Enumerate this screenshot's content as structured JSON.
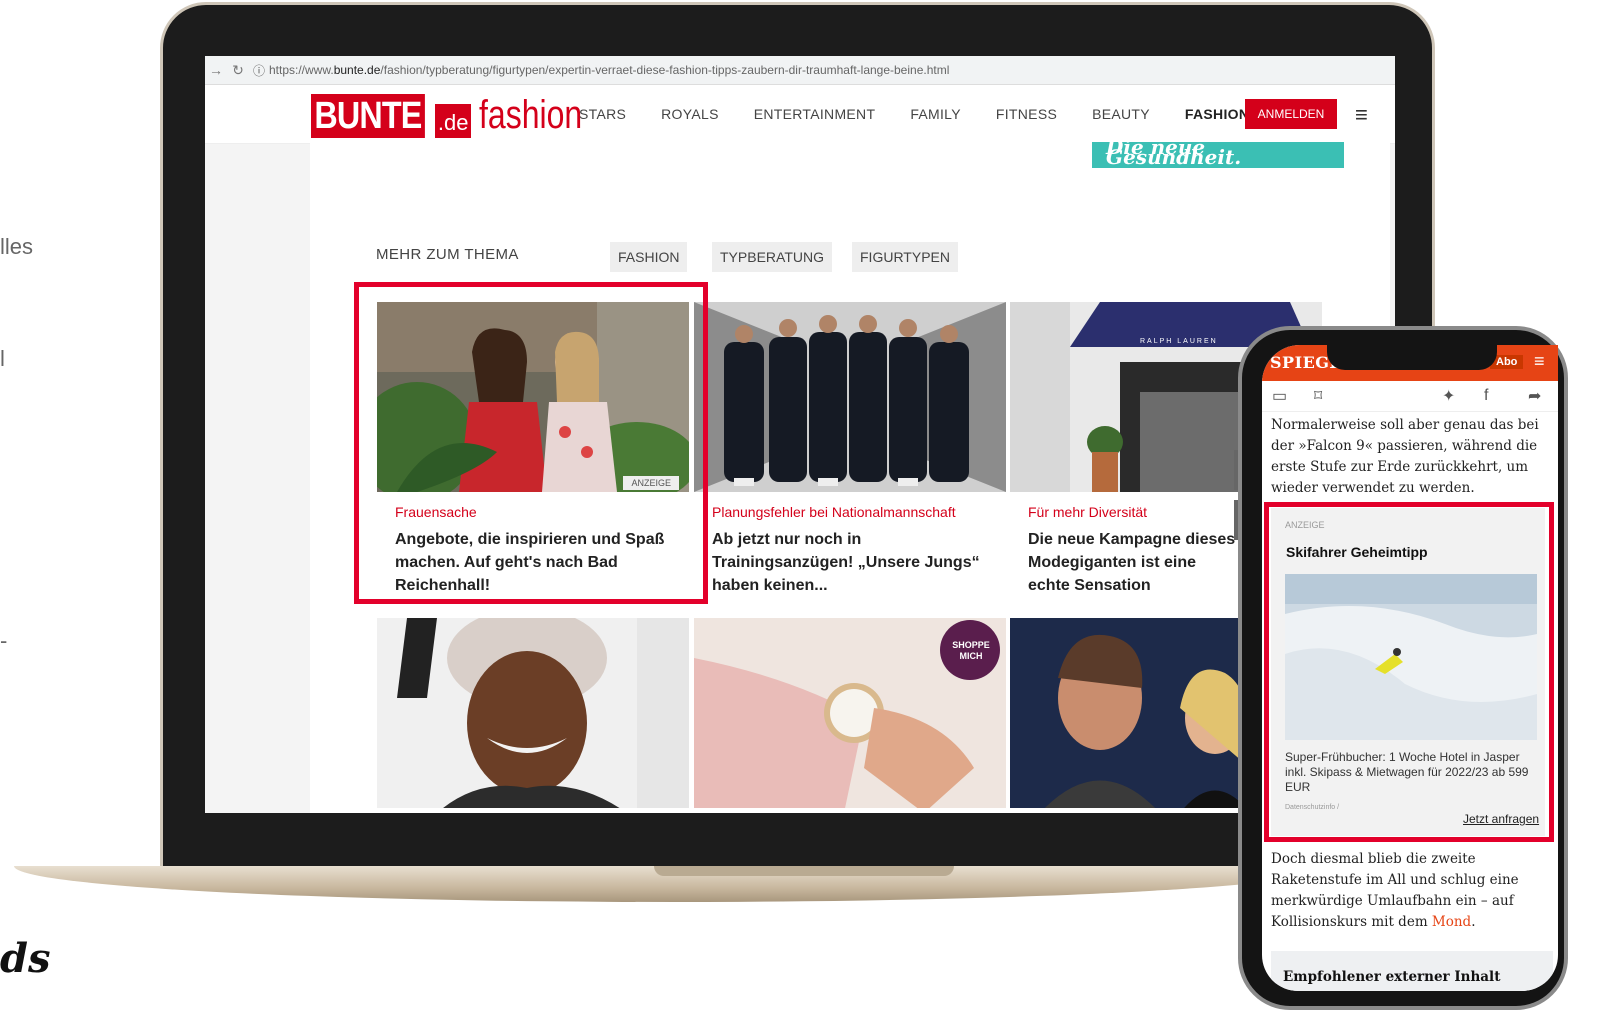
{
  "slide": {
    "frag1": "lles",
    "frag2": "l",
    "frag3": "-",
    "script_frag": "ds"
  },
  "browser": {
    "url_prefix": "https://www.",
    "url_domain": "bunte.de",
    "url_path": "/fashion/typberatung/figurtypen/expertin-verraet-diese-fashion-tipps-zaubern-dir-traumhaft-lange-beine.html"
  },
  "bunte": {
    "logo_main": "BUNTE",
    "logo_de": ".de",
    "logo_section": "fashion",
    "nav": [
      "STARS",
      "ROYALS",
      "ENTERTAINMENT",
      "FAMILY",
      "FITNESS",
      "BEAUTY",
      "FASHION"
    ],
    "login_label": "ANMELDEN",
    "banner_text": "Die neue Gesundheit.",
    "mehr_zum_thema": "MEHR ZUM THEMA",
    "tags": [
      "FASHION",
      "TYPBERATUNG",
      "FIGURTYPEN"
    ],
    "cards": [
      {
        "kicker": "Frauensache",
        "headline": "Angebote, die inspirieren und Spaß machen. Auf geht's nach Bad Reichenhall!",
        "badge": "ANZEIGE"
      },
      {
        "kicker": "Planungsfehler bei Nationalmannschaft",
        "headline": "Ab jetzt nur noch in Trainingsanzügen! „Unsere Jungs“ haben keinen..."
      },
      {
        "kicker": "Für mehr Diversität",
        "headline": "Die neue Kampagne dieses Modegiganten ist eine echte Sensation"
      }
    ],
    "shoppe_badge": "SHOPPE MICH",
    "store_sign": "RALPH LAUREN"
  },
  "spiegel": {
    "logo": "SPIEGEL",
    "abo": "Abo",
    "para1": "Normalerweise soll aber genau das bei der »Falcon 9« passieren, während die erste Stufe zur Erde zurückkehrt, um wieder verwendet zu werden.",
    "ad_label": "ANZEIGE",
    "ad_title": "Skifahrer Geheimtipp",
    "ad_desc": "Super-Frühbucher: 1 Woche Hotel in Jasper inkl. Skipass & Mietwagen für 2022/23 ab 599 EUR",
    "ad_fine": "Datenschutzinfo /",
    "ad_cta": "Jetzt anfragen",
    "para2_a": "Doch diesmal blieb die zweite Raketenstufe im All und schlug eine merkwürdige Umlaufbahn ein – auf Kollisionskurs mit dem ",
    "para2_link": "Mond",
    "para2_b": ".",
    "empfohlen": "Empfohlener externer Inhalt"
  },
  "colors": {
    "bunte_red": "#d4001a",
    "highlight_red": "#e3002b",
    "spiegel_orange": "#e64415",
    "teal": "#3bbfb4"
  }
}
